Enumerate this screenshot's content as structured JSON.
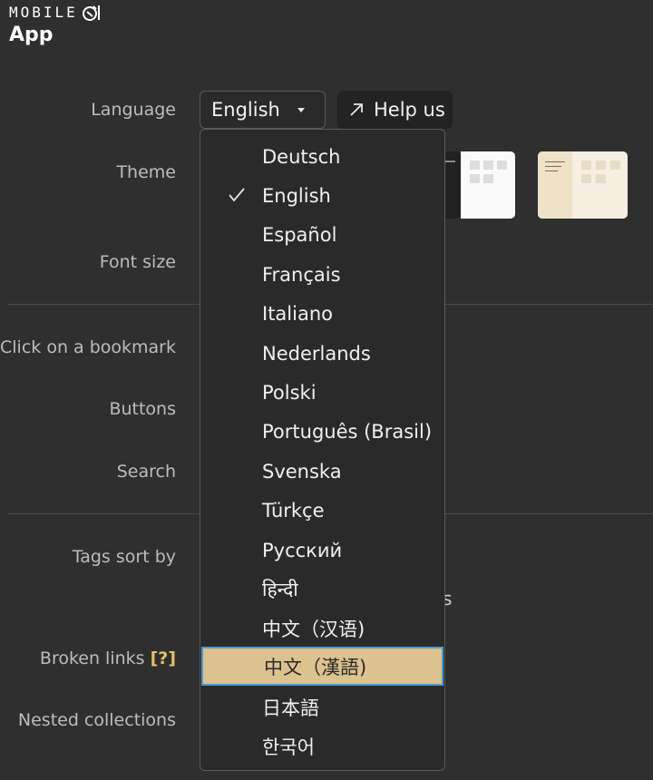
{
  "header": {
    "logo_text": "MOBILE",
    "app_title": "App"
  },
  "settings": {
    "language_label": "Language",
    "theme_label": "Theme",
    "font_size_label": "Font size",
    "click_bookmark_label": "Click on a bookmark",
    "buttons_label": "Buttons",
    "search_label": "Search",
    "tags_sort_label": "Tags sort by",
    "broken_links_label": "Broken links",
    "broken_links_help": "[?]",
    "nested_collections_label": "Nested collections",
    "partial_text": "s"
  },
  "language_select": {
    "value": "English",
    "help_label": "Help us"
  },
  "language_options": [
    {
      "label": "Deutsch"
    },
    {
      "label": "English",
      "checked": true
    },
    {
      "label": "Español"
    },
    {
      "label": "Français"
    },
    {
      "label": "Italiano"
    },
    {
      "label": "Nederlands"
    },
    {
      "label": "Polski"
    },
    {
      "label": "Português (Brasil)"
    },
    {
      "label": "Svenska"
    },
    {
      "label": "Türkçe"
    },
    {
      "label": "Русский"
    },
    {
      "label": "हिन्दी"
    },
    {
      "label": "中文（汉语)"
    },
    {
      "label": "中文（漢語)",
      "highlighted": true
    },
    {
      "label": "日本語"
    },
    {
      "label": "한국어"
    }
  ],
  "colors": {
    "background": "#2f2f2f",
    "highlight": "#dcc28e",
    "focus_ring": "#4b9bd6",
    "accent": "#e2c06a"
  }
}
